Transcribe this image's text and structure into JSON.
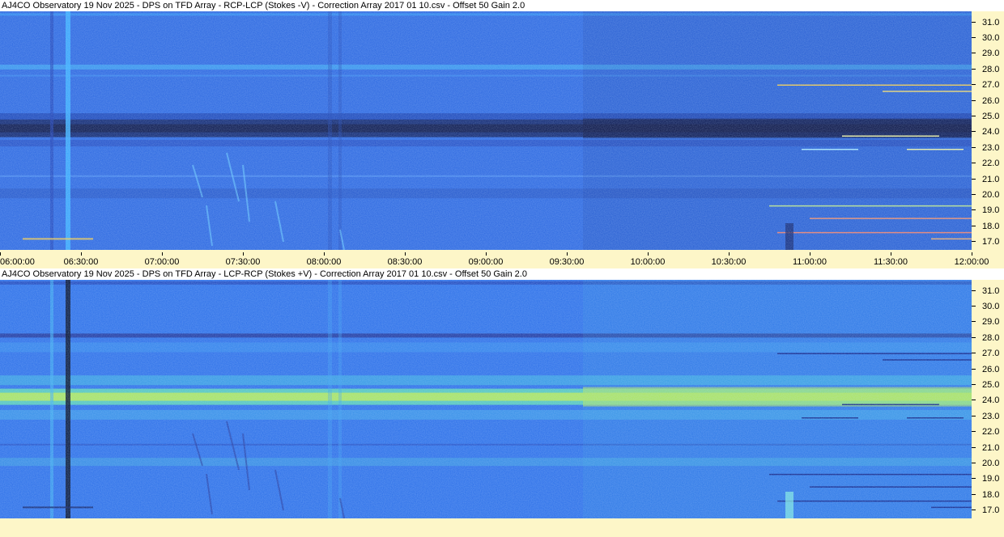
{
  "panels": [
    {
      "title": "AJ4CO Observatory 19 Nov 2025  -  DPS on TFD Array  -  RCP-LCP (Stokes -V)  -  Correction Array 2017 01 10.csv  -  Offset 50  Gain 2.0",
      "polarity": "negative"
    },
    {
      "title": "AJ4CO Observatory 19 Nov 2025  -  DPS on TFD Array  -  LCP-RCP (Stokes +V)  -  Correction Array 2017 01 10.csv  -  Offset 50  Gain 2.0",
      "polarity": "positive"
    }
  ],
  "chart_data": {
    "type": "heatmap",
    "x_ticks": [
      "06:00:00",
      "06:30:00",
      "07:00:00",
      "07:30:00",
      "08:00:00",
      "08:30:00",
      "09:00:00",
      "09:30:00",
      "10:00:00",
      "10:30:00",
      "11:00:00",
      "11:30:00",
      "12:00:00"
    ],
    "xlim": [
      "06:00:00",
      "12:00:00"
    ],
    "y_ticks": [
      "31.0",
      "30.0",
      "29.0",
      "28.0",
      "27.0",
      "26.0",
      "25.0",
      "24.0",
      "23.0",
      "22.0",
      "21.0",
      "20.0",
      "19.0",
      "18.0",
      "17.0"
    ],
    "ylim": [
      16.5,
      31.7
    ],
    "colormap": [
      "#2a0a6a",
      "#1a3ad0",
      "#2a6cf0",
      "#3aa0f0",
      "#40d0d0",
      "#b0f060",
      "#f0f040"
    ]
  },
  "colors": {
    "background": "#fdf6c8",
    "title_background": "#ffffff",
    "blue_base": "#2a66e0",
    "dark_band": "#0a1a5a",
    "bright_band": "#c8f040"
  }
}
